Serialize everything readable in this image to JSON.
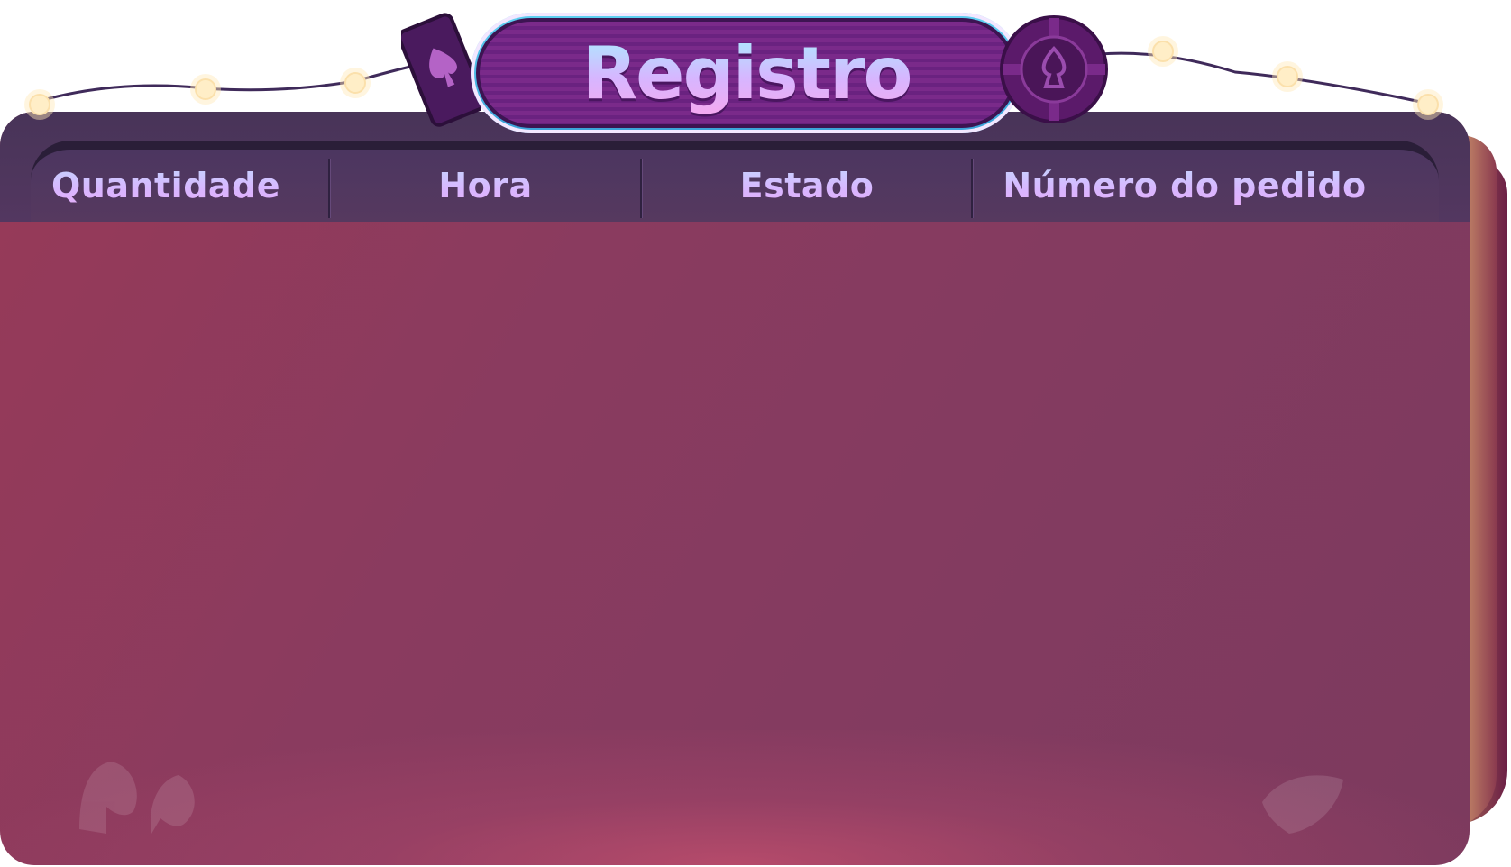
{
  "title": "Registro",
  "table": {
    "columns": [
      {
        "label": "Quantidade"
      },
      {
        "label": "Hora"
      },
      {
        "label": "Estado"
      },
      {
        "label": "Número do pedido"
      }
    ],
    "rows": []
  },
  "colors": {
    "panel": "#8a3b5f",
    "header": "#4c3660",
    "title_border": "#5fd1f2",
    "title_fill": "#7a2a8a"
  },
  "icons": {
    "left": "spade-card-icon",
    "right": "poker-chip-icon",
    "decor": "string-lights"
  }
}
